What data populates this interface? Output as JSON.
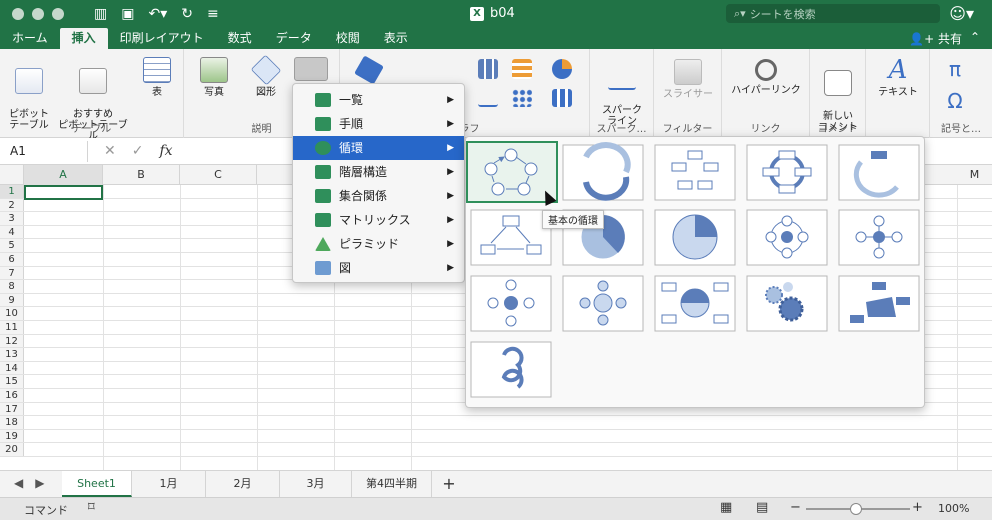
{
  "window": {
    "title": "b04",
    "search_placeholder": "シートを検索"
  },
  "tabs": [
    "ホーム",
    "挿入",
    "印刷レイアウト",
    "数式",
    "データ",
    "校閲",
    "表示"
  ],
  "active_tab": "挿入",
  "share_label": "共有",
  "ribbon": {
    "groups": [
      "テーブル",
      "説明",
      "グラフ",
      "スパーク…",
      "フィルター",
      "リンク",
      "コメント",
      "記号と…"
    ],
    "buttons": {
      "pivot": "ピボット\nテーブル",
      "recommended_pivot": "おすすめ\nピボットテーブル",
      "table": "表",
      "photo": "写真",
      "shapes": "図形",
      "sparkline": "スパーク\nライン",
      "slicer": "スライサー",
      "hyperlink": "ハイパーリンク",
      "new_comment": "新しい\nコメント",
      "text": "テキスト",
      "pi": "π",
      "omega": "Ω"
    }
  },
  "formula_bar": {
    "name_box": "A1",
    "fx": "fx"
  },
  "columns": [
    "A",
    "B",
    "C",
    "M"
  ],
  "rows": [
    "1",
    "2",
    "3",
    "4",
    "5",
    "6",
    "7",
    "8",
    "9",
    "10",
    "11",
    "12",
    "13",
    "14",
    "15",
    "16",
    "17",
    "18",
    "19",
    "20"
  ],
  "sheet_tabs": [
    "Sheet1",
    "1月",
    "2月",
    "3月",
    "第4四半期"
  ],
  "active_sheet": "Sheet1",
  "add_sheet": "+",
  "status": {
    "mode": "コマンド",
    "zoom": "100%",
    "minus": "−",
    "plus": "+"
  },
  "smartart_menu": {
    "items": [
      {
        "label": "一覧",
        "active": false
      },
      {
        "label": "手順",
        "active": false
      },
      {
        "label": "循環",
        "active": true
      },
      {
        "label": "階層構造",
        "active": false
      },
      {
        "label": "集合関係",
        "active": false
      },
      {
        "label": "マトリックス",
        "active": false
      },
      {
        "label": "ピラミッド",
        "active": false
      },
      {
        "label": "図",
        "active": false
      }
    ]
  },
  "tooltip": "基本の循環",
  "colors": {
    "excel_green": "#217346",
    "menu_highlight": "#2767c9",
    "smartart_blue": "#5b7db9"
  }
}
